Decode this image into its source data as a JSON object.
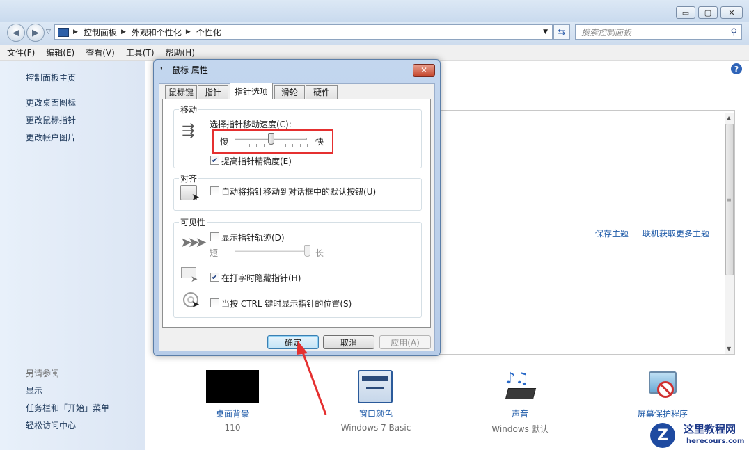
{
  "window": {
    "caption_buttons": [
      "▭",
      "▢",
      "✕"
    ]
  },
  "address": {
    "crumbs": [
      "控制面板",
      "外观和个性化",
      "个性化"
    ],
    "search_placeholder": "搜索控制面板"
  },
  "menu": [
    "文件(F)",
    "编辑(E)",
    "查看(V)",
    "工具(T)",
    "帮助(H)"
  ],
  "sidebar": {
    "home": "控制面板主页",
    "links": [
      "更改桌面图标",
      "更改鼠标指针",
      "更改帐户图片"
    ],
    "see_also_title": "另请参阅",
    "see_also": [
      "显示",
      "任务栏和「开始」菜单",
      "轻松访问中心"
    ]
  },
  "main": {
    "save_theme": "保存主题",
    "more_themes": "联机获取更多主题"
  },
  "tiles": [
    {
      "label": "桌面背景",
      "sub": "110"
    },
    {
      "label": "窗口颜色",
      "sub": "Windows 7 Basic"
    },
    {
      "label": "声音",
      "sub": "Windows 默认"
    },
    {
      "label": "屏幕保护程序",
      "sub": ""
    }
  ],
  "dialog": {
    "title": "鼠标 属性",
    "tabs": [
      "鼠标键",
      "指针",
      "指针选项",
      "滑轮",
      "硬件"
    ],
    "active_tab": "指针选项",
    "motion": {
      "group": "移动",
      "speed_label": "选择指针移动速度(C):",
      "slow": "慢",
      "fast": "快",
      "speed_fraction": 0.5,
      "precision_label": "提高指针精确度(E)",
      "precision_checked": true
    },
    "snap": {
      "group": "对齐",
      "label": "自动将指针移动到对话框中的默认按钮(U)",
      "checked": false
    },
    "visibility": {
      "group": "可见性",
      "trails_label": "显示指针轨迹(D)",
      "trails_checked": false,
      "short": "短",
      "long": "长",
      "trails_fraction": 1.0,
      "hide_label": "在打字时隐藏指针(H)",
      "hide_checked": true,
      "ctrl_label": "当按 CTRL 键时显示指针的位置(S)",
      "ctrl_checked": false
    },
    "buttons": {
      "ok": "确定",
      "cancel": "取消",
      "apply": "应用(A)"
    }
  },
  "watermark": {
    "name": "这里教程网",
    "url": "herecours.com"
  },
  "colors": {
    "highlight_box": "#e53030",
    "arrow": "#e53030",
    "link": "#1e5aa8"
  }
}
